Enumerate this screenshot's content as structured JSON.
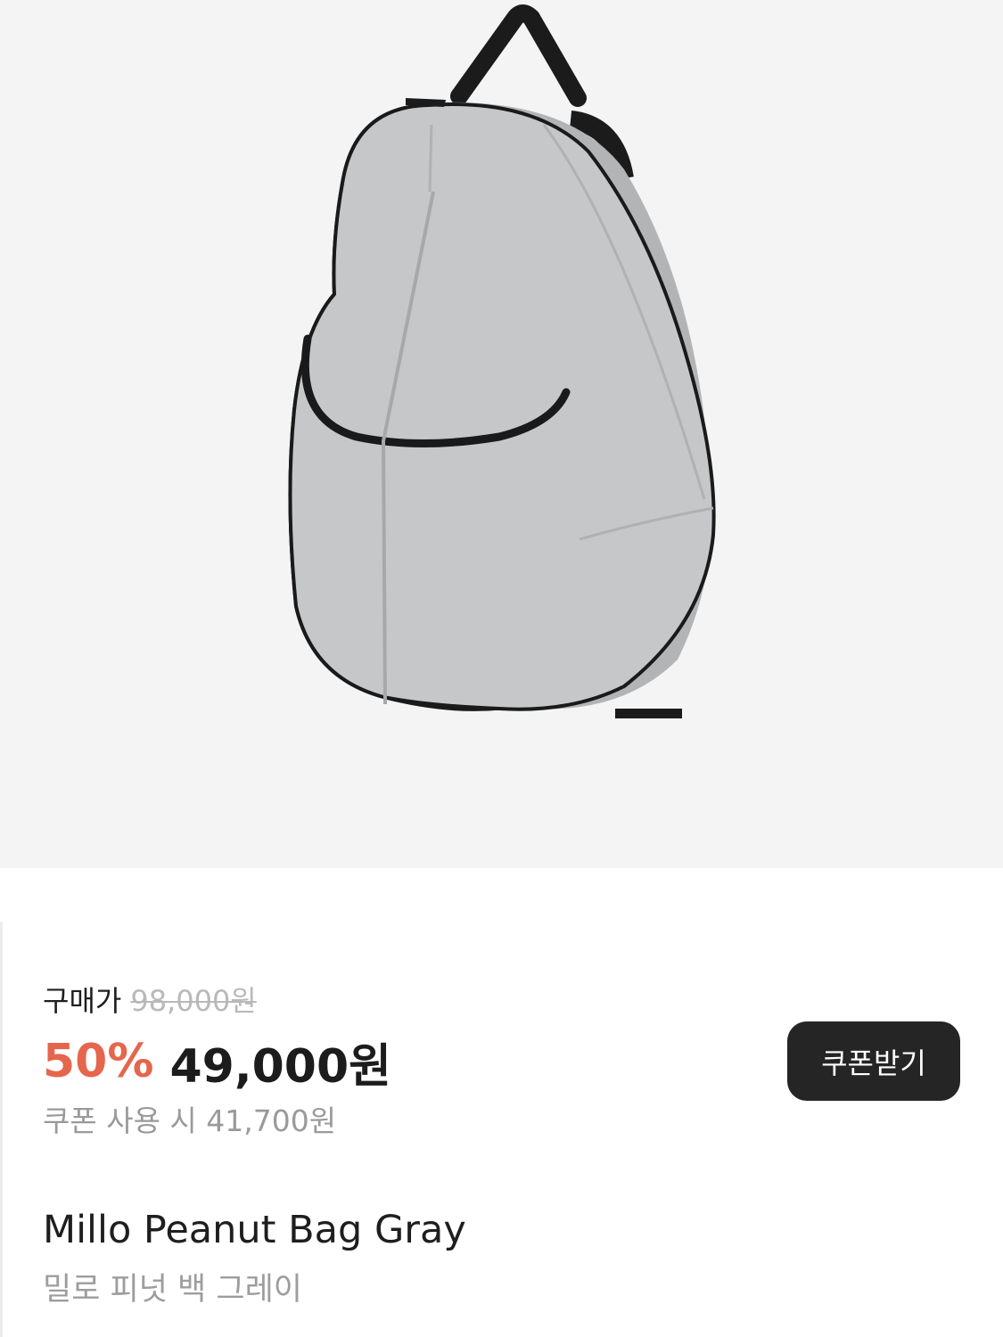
{
  "product": {
    "image_icon": "backpack-image",
    "price_label": "구매가",
    "original_price": "98,000원",
    "discount_rate": "50%",
    "sale_price": "49,000원",
    "coupon_price": "쿠폰 사용 시 41,700원",
    "coupon_button_label": "쿠폰받기",
    "name_en": "Millo Peanut Bag Gray",
    "name_ko": "밀로 피넛 백 그레이"
  },
  "colors": {
    "discount": "#e5664d",
    "button_bg": "#252525",
    "hero_bg": "#f4f4f4",
    "bag_body": "#c4c5c6",
    "bag_trim": "#1a1a1a"
  }
}
